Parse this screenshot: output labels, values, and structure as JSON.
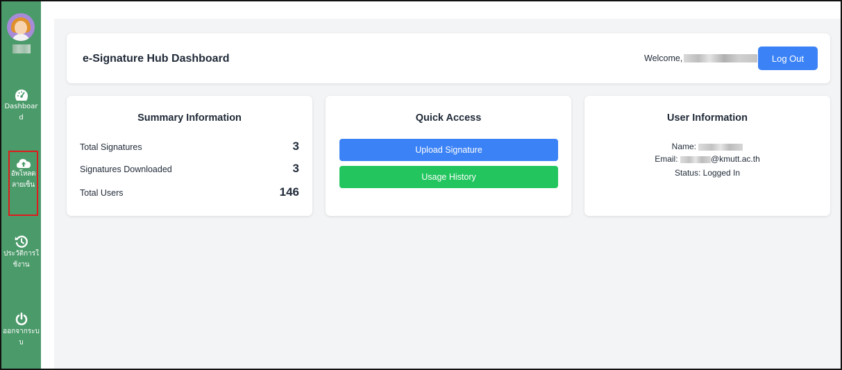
{
  "sidebar": {
    "dashboard_label": "Dashboard",
    "upload_label": "อัพโหลดลายเซ็น",
    "history_label": "ประวัติการใช้งาน",
    "logout_label": "ออกจากระบบ",
    "accent": "#4b9a6a",
    "highlight_color": "#e01b1b"
  },
  "header": {
    "title": "e-Signature Hub Dashboard",
    "welcome": "Welcome,",
    "logout_button": "Log Out"
  },
  "summary": {
    "title": "Summary Information",
    "rows": [
      {
        "label": "Total Signatures",
        "value": "3"
      },
      {
        "label": "Signatures Downloaded",
        "value": "3"
      },
      {
        "label": "Total Users",
        "value": "146"
      }
    ]
  },
  "quick_access": {
    "title": "Quick Access",
    "upload_button": "Upload Signature",
    "history_button": "Usage History"
  },
  "user_info": {
    "title": "User Information",
    "name_label": "Name:",
    "email_label": "Email:",
    "email_domain": "@kmutt.ac.th",
    "status": "Status: Logged In"
  },
  "colors": {
    "primary": "#3b82f6",
    "success": "#22c55e",
    "background": "#f3f4f6"
  }
}
